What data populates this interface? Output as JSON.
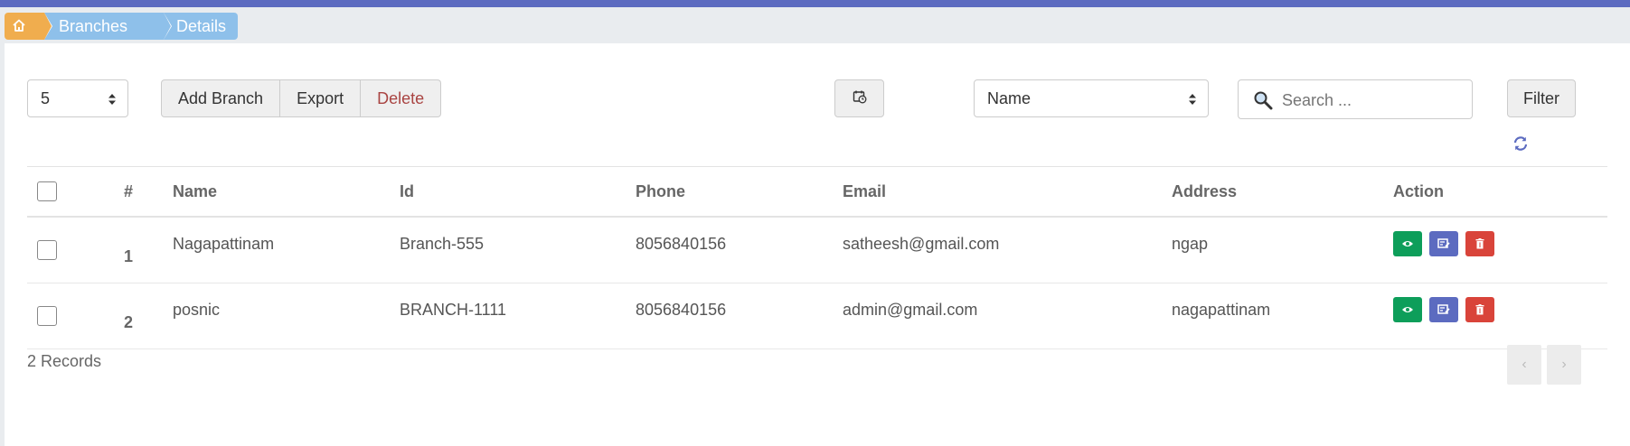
{
  "breadcrumb": {
    "items": [
      {
        "icon": "home-icon"
      },
      {
        "label": "Branches"
      },
      {
        "label": "Details"
      }
    ]
  },
  "toolbar": {
    "page_size": "5",
    "add_label": "Add Branch",
    "export_label": "Export",
    "delete_label": "Delete",
    "sort_field": "Name",
    "search_placeholder": "Search ...",
    "filter_label": "Filter"
  },
  "table": {
    "columns": [
      "#",
      "Name",
      "Id",
      "Phone",
      "Email",
      "Address",
      "Action"
    ],
    "rows": [
      {
        "num": "1",
        "name": "Nagapattinam",
        "id": "Branch-555",
        "phone": "8056840156",
        "email": "satheesh@gmail.com",
        "address": "ngap"
      },
      {
        "num": "2",
        "name": "posnic",
        "id": "BRANCH-1111",
        "phone": "8056840156",
        "email": "admin@gmail.com",
        "address": "nagapattinam"
      }
    ]
  },
  "footer": {
    "records": "2 Records",
    "prev": "‹",
    "next": "›"
  },
  "colors": {
    "topbar": "#5c6bc0",
    "home_crumb": "#f0ad4e",
    "crumb": "#8ec0ea",
    "view": "#0d9e5a",
    "edit": "#5c6bc0",
    "delete": "#d9443a"
  }
}
